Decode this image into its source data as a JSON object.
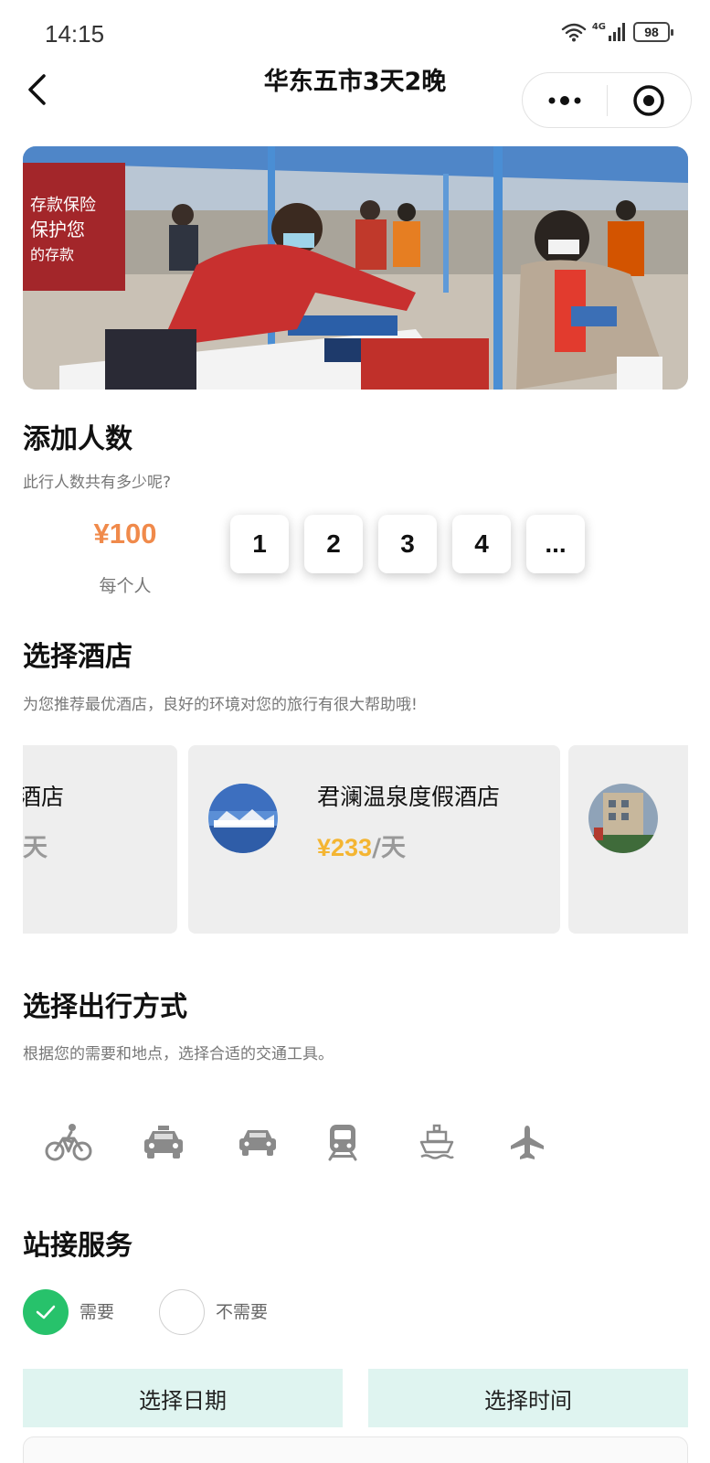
{
  "status_bar": {
    "time": "14:15",
    "network": "4G",
    "battery": "98"
  },
  "header": {
    "title": "华东五市3天2晚"
  },
  "people": {
    "title": "添加人数",
    "subtitle": "此行人数共有多少呢?",
    "price": "¥100",
    "price_unit": "每个人",
    "options": [
      "1",
      "2",
      "3",
      "4",
      "..."
    ]
  },
  "hotel": {
    "title": "选择酒店",
    "subtitle": "为您推荐最优酒店，良好的环境对您的旅行有很大帮助哦!",
    "cards": [
      {
        "name_fragment": "酒店",
        "per_fragment": "天"
      },
      {
        "name": "君澜温泉度假酒店",
        "price": "¥233",
        "per": "/天"
      }
    ]
  },
  "transport": {
    "title": "选择出行方式",
    "subtitle": "根据您的需要和地点，选择合适的交通工具。",
    "icons": [
      "bicycle-icon",
      "taxi-icon",
      "car-icon",
      "train-icon",
      "ship-icon",
      "airplane-icon"
    ]
  },
  "pickup": {
    "title": "站接服务",
    "options": [
      {
        "label": "需要",
        "selected": true
      },
      {
        "label": "不需要",
        "selected": false
      }
    ]
  },
  "actions": {
    "date": "选择日期",
    "time": "选择时间"
  },
  "colors": {
    "accent_green": "#27c26b",
    "price_orange": "#f08a4b",
    "hotel_price_yellow": "#f4b532",
    "button_mint": "#dff4f0"
  }
}
